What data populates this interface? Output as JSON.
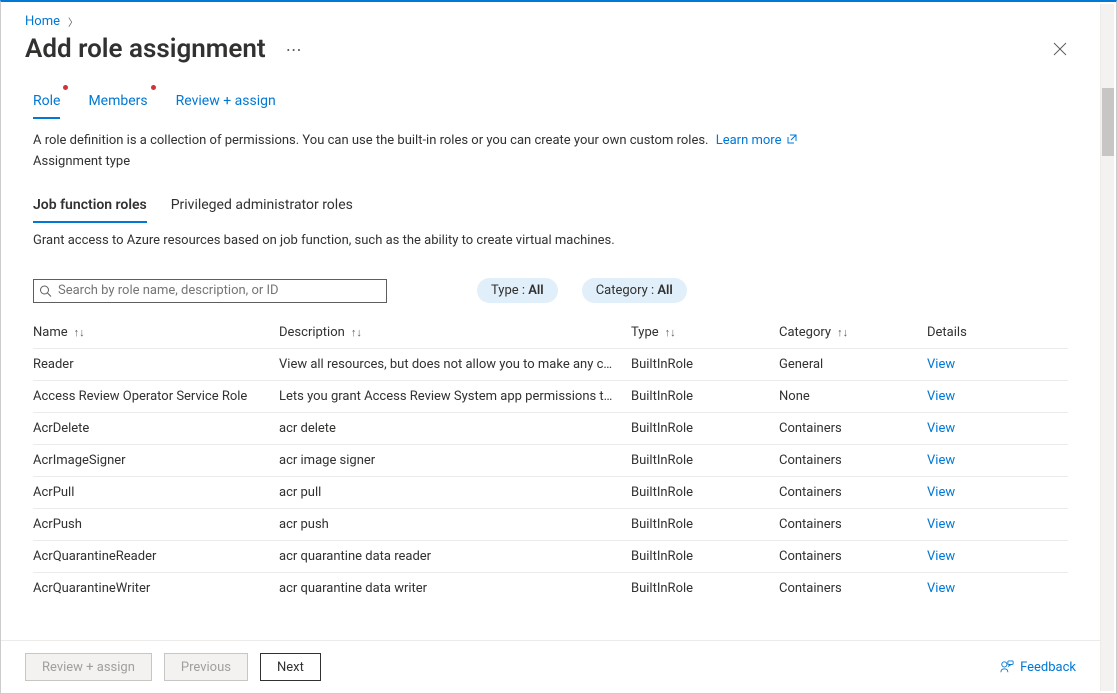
{
  "breadcrumb": {
    "home": "Home"
  },
  "title": "Add role assignment",
  "steps": [
    {
      "label": "Role",
      "active": true,
      "dot": true
    },
    {
      "label": "Members",
      "active": false,
      "dot": true
    },
    {
      "label": "Review + assign",
      "active": false,
      "dot": false
    }
  ],
  "description": "A role definition is a collection of permissions. You can use the built-in roles or you can create your own custom roles.",
  "learn_more": "Learn more",
  "assignment_type_label": "Assignment type",
  "subtabs": [
    {
      "label": "Job function roles",
      "active": true
    },
    {
      "label": "Privileged administrator roles",
      "active": false
    }
  ],
  "subtab_description": "Grant access to Azure resources based on job function, such as the ability to create virtual machines.",
  "search_placeholder": "Search by role name, description, or ID",
  "filters": {
    "type_label": "Type : ",
    "type_value": "All",
    "category_label": "Category : ",
    "category_value": "All"
  },
  "columns": {
    "name": "Name",
    "description": "Description",
    "type": "Type",
    "category": "Category",
    "details": "Details"
  },
  "view_label": "View",
  "rows": [
    {
      "name": "Reader",
      "description": "View all resources, but does not allow you to make any ch…",
      "type": "BuiltInRole",
      "category": "General"
    },
    {
      "name": "Access Review Operator Service Role",
      "description": "Lets you grant Access Review System app permissions to …",
      "type": "BuiltInRole",
      "category": "None"
    },
    {
      "name": "AcrDelete",
      "description": "acr delete",
      "type": "BuiltInRole",
      "category": "Containers"
    },
    {
      "name": "AcrImageSigner",
      "description": "acr image signer",
      "type": "BuiltInRole",
      "category": "Containers"
    },
    {
      "name": "AcrPull",
      "description": "acr pull",
      "type": "BuiltInRole",
      "category": "Containers"
    },
    {
      "name": "AcrPush",
      "description": "acr push",
      "type": "BuiltInRole",
      "category": "Containers"
    },
    {
      "name": "AcrQuarantineReader",
      "description": "acr quarantine data reader",
      "type": "BuiltInRole",
      "category": "Containers"
    },
    {
      "name": "AcrQuarantineWriter",
      "description": "acr quarantine data writer",
      "type": "BuiltInRole",
      "category": "Containers"
    }
  ],
  "footer": {
    "review": "Review + assign",
    "previous": "Previous",
    "next": "Next",
    "feedback": "Feedback"
  }
}
